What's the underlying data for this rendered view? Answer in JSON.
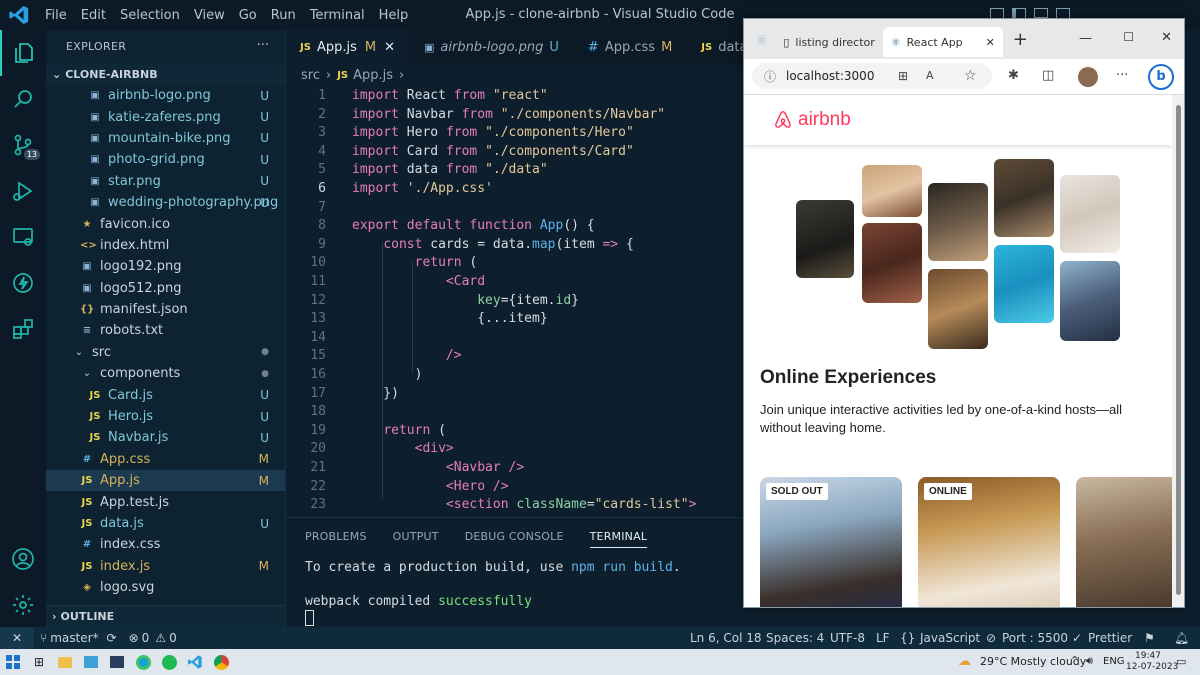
{
  "window": {
    "title": "App.js - clone-airbnb - Visual Studio Code"
  },
  "menu": [
    "File",
    "Edit",
    "Selection",
    "View",
    "Go",
    "Run",
    "Terminal",
    "Help"
  ],
  "activity": {
    "scm_badge": "13"
  },
  "explorer": {
    "title": "EXPLORER",
    "more": "···",
    "root": "CLONE-AIRBNB",
    "items": [
      {
        "name": "airbnb-logo.png",
        "status": "U",
        "icon": "image-file-icon",
        "indent": 1
      },
      {
        "name": "katie-zaferes.png",
        "status": "U",
        "icon": "image-file-icon",
        "indent": 1
      },
      {
        "name": "mountain-bike.png",
        "status": "U",
        "icon": "image-file-icon",
        "indent": 1
      },
      {
        "name": "photo-grid.png",
        "status": "U",
        "icon": "image-file-icon",
        "indent": 1
      },
      {
        "name": "star.png",
        "status": "U",
        "icon": "image-file-icon",
        "indent": 1
      },
      {
        "name": "wedding-photography.png",
        "status": "U",
        "icon": "image-file-icon",
        "indent": 1
      },
      {
        "name": "favicon.ico",
        "status": "",
        "icon": "star-file-icon",
        "indent": 0
      },
      {
        "name": "index.html",
        "status": "",
        "icon": "html-file-icon",
        "indent": 0
      },
      {
        "name": "logo192.png",
        "status": "",
        "icon": "image-file-icon",
        "indent": 0
      },
      {
        "name": "logo512.png",
        "status": "",
        "icon": "image-file-icon",
        "indent": 0
      },
      {
        "name": "manifest.json",
        "status": "",
        "icon": "json-file-icon",
        "indent": 0
      },
      {
        "name": "robots.txt",
        "status": "",
        "icon": "text-file-icon",
        "indent": 0
      },
      {
        "name": "src",
        "status": "●",
        "icon": "folder-chevron-icon",
        "indent": -1
      },
      {
        "name": "components",
        "status": "●",
        "icon": "folder-chevron-icon",
        "indent": 0
      },
      {
        "name": "Card.js",
        "status": "U",
        "icon": "js-file-icon",
        "indent": 1
      },
      {
        "name": "Hero.js",
        "status": "U",
        "icon": "js-file-icon",
        "indent": 1
      },
      {
        "name": "Navbar.js",
        "status": "U",
        "icon": "js-file-icon",
        "indent": 1
      },
      {
        "name": "App.css",
        "status": "M",
        "icon": "css-file-icon",
        "indent": 0
      },
      {
        "name": "App.js",
        "status": "M",
        "icon": "js-file-icon",
        "indent": 0,
        "selected": true
      },
      {
        "name": "App.test.js",
        "status": "",
        "icon": "js-file-icon",
        "indent": 0
      },
      {
        "name": "data.js",
        "status": "U",
        "icon": "js-file-icon",
        "indent": 0
      },
      {
        "name": "index.css",
        "status": "",
        "icon": "css-file-icon",
        "indent": 0
      },
      {
        "name": "index.js",
        "status": "M",
        "icon": "js-file-icon",
        "indent": 0
      },
      {
        "name": "logo.svg",
        "status": "",
        "icon": "svg-file-icon",
        "indent": 0
      }
    ],
    "outline": "OUTLINE"
  },
  "tabs": [
    {
      "icon": "JS",
      "label": "App.js",
      "status": "M",
      "active": true
    },
    {
      "icon": "img",
      "label": "airbnb-logo.png",
      "status": "U",
      "active": false
    },
    {
      "icon": "#",
      "label": "App.css",
      "status": "M",
      "active": false
    },
    {
      "icon": "JS",
      "label": "data.js",
      "status": "",
      "active": false
    }
  ],
  "breadcrumb": {
    "part1": "src",
    "part2": "App.js"
  },
  "code": [
    "1",
    "2",
    "3",
    "4",
    "5",
    "6",
    "7",
    "8",
    "9",
    "10",
    "11",
    "12",
    "13",
    "14",
    "15",
    "16",
    "17",
    "18",
    "19",
    "20",
    "21",
    "22",
    "23"
  ],
  "panel": {
    "tabs": [
      "PROBLEMS",
      "OUTPUT",
      "DEBUG CONSOLE",
      "TERMINAL"
    ],
    "active": "TERMINAL",
    "line1_a": "To create a production build, use ",
    "line1_b": "npm run build",
    "line1_c": ".",
    "line2_a": "webpack compiled ",
    "line2_b": "successfully"
  },
  "status": {
    "branch": "master*",
    "errors": "0",
    "warnings": "0",
    "position": "Ln 6, Col 18",
    "spaces": "Spaces: 4",
    "encoding": "UTF-8",
    "eol": "LF",
    "language": "JavaScript",
    "port": "Port : 5500",
    "prettier": "Prettier"
  },
  "browser": {
    "tab1": "listing director",
    "tab2": "React App",
    "url": "localhost:3000",
    "page": {
      "logo": "airbnb",
      "heading": "Online Experiences",
      "subtitle": "Join unique interactive activities led by one-of-a-kind hosts—all without leaving home.",
      "badge1": "SOLD OUT",
      "badge2": "ONLINE"
    }
  },
  "taskbar": {
    "weather": "29°C  Mostly cloudy",
    "lang": "ENG",
    "time": "19:47",
    "date": "12-07-2023"
  }
}
